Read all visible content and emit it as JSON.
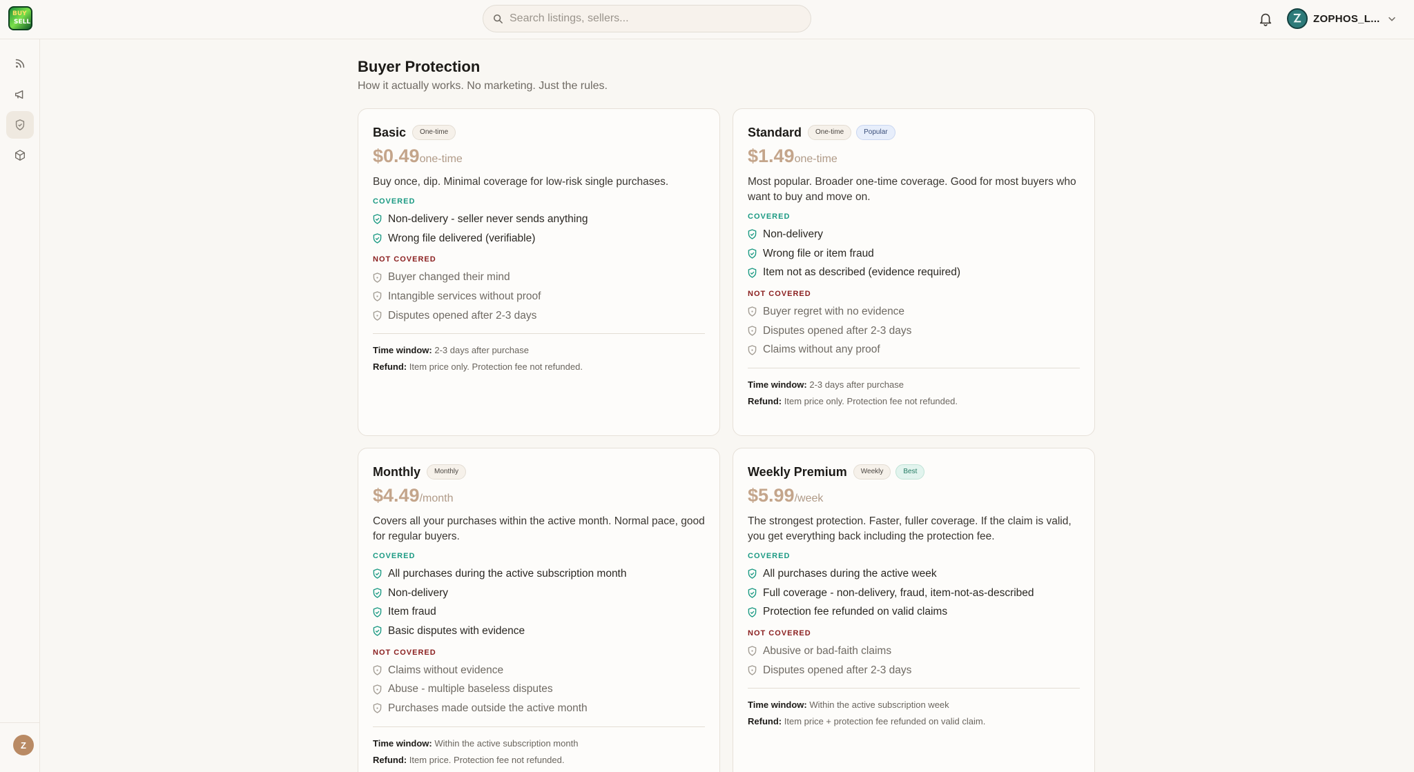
{
  "logo": {
    "text": "BUY SELL"
  },
  "search": {
    "placeholder": "Search listings, sellers..."
  },
  "user": {
    "name": "ZOPHOS_L..."
  },
  "sidebar": {
    "avatar_initial": "Z"
  },
  "page": {
    "title": "Buyer Protection",
    "subtitle": "How it actually works. No marketing. Just the rules."
  },
  "plans": [
    {
      "name": "Basic",
      "badges": [
        "One-time"
      ],
      "price": "$0.49",
      "unit": "one-time",
      "description": "Buy once, dip. Minimal coverage for low-risk single purchases.",
      "covered_label": "COVERED",
      "covered": [
        "Non-delivery - seller never sends anything",
        "Wrong file delivered (verifiable)"
      ],
      "not_covered_label": "NOT COVERED",
      "not_covered": [
        "Buyer changed their mind",
        "Intangible services without proof",
        "Disputes opened after 2-3 days"
      ],
      "time_label": "Time window:",
      "time_value": "2-3 days after purchase",
      "refund_label": "Refund:",
      "refund_value": "Item price only. Protection fee not refunded."
    },
    {
      "name": "Standard",
      "badges": [
        "One-time",
        "Popular"
      ],
      "price": "$1.49",
      "unit": "one-time",
      "description": "Most popular. Broader one-time coverage. Good for most buyers who want to buy and move on.",
      "covered_label": "COVERED",
      "covered": [
        "Non-delivery",
        "Wrong file or item fraud",
        "Item not as described (evidence required)"
      ],
      "not_covered_label": "NOT COVERED",
      "not_covered": [
        "Buyer regret with no evidence",
        "Disputes opened after 2-3 days",
        "Claims without any proof"
      ],
      "time_label": "Time window:",
      "time_value": "2-3 days after purchase",
      "refund_label": "Refund:",
      "refund_value": "Item price only. Protection fee not refunded."
    },
    {
      "name": "Monthly",
      "badges": [
        "Monthly"
      ],
      "price": "$4.49",
      "unit": "/month",
      "description": "Covers all your purchases within the active month. Normal pace, good for regular buyers.",
      "covered_label": "COVERED",
      "covered": [
        "All purchases during the active subscription month",
        "Non-delivery",
        "Item fraud",
        "Basic disputes with evidence"
      ],
      "not_covered_label": "NOT COVERED",
      "not_covered": [
        "Claims without evidence",
        "Abuse - multiple baseless disputes",
        "Purchases made outside the active month"
      ],
      "time_label": "Time window:",
      "time_value": "Within the active subscription month",
      "refund_label": "Refund:",
      "refund_value": "Item price. Protection fee not refunded."
    },
    {
      "name": "Weekly Premium",
      "badges": [
        "Weekly",
        "Best"
      ],
      "price": "$5.99",
      "unit": "/week",
      "description": "The strongest protection. Faster, fuller coverage. If the claim is valid, you get everything back including the protection fee.",
      "covered_label": "COVERED",
      "covered": [
        "All purchases during the active week",
        "Full coverage - non-delivery, fraud, item-not-as-described",
        "Protection fee refunded on valid claims"
      ],
      "not_covered_label": "NOT COVERED",
      "not_covered": [
        "Abusive or bad-faith claims",
        "Disputes opened after 2-3 days"
      ],
      "time_label": "Time window:",
      "time_value": "Within the active subscription week",
      "refund_label": "Refund:",
      "refund_value": "Item price + protection fee refunded on valid claim."
    }
  ],
  "colors": {
    "accent_green": "#1b9a83",
    "not_covered_red": "#8a1e1e",
    "price": "#c4a58b"
  }
}
